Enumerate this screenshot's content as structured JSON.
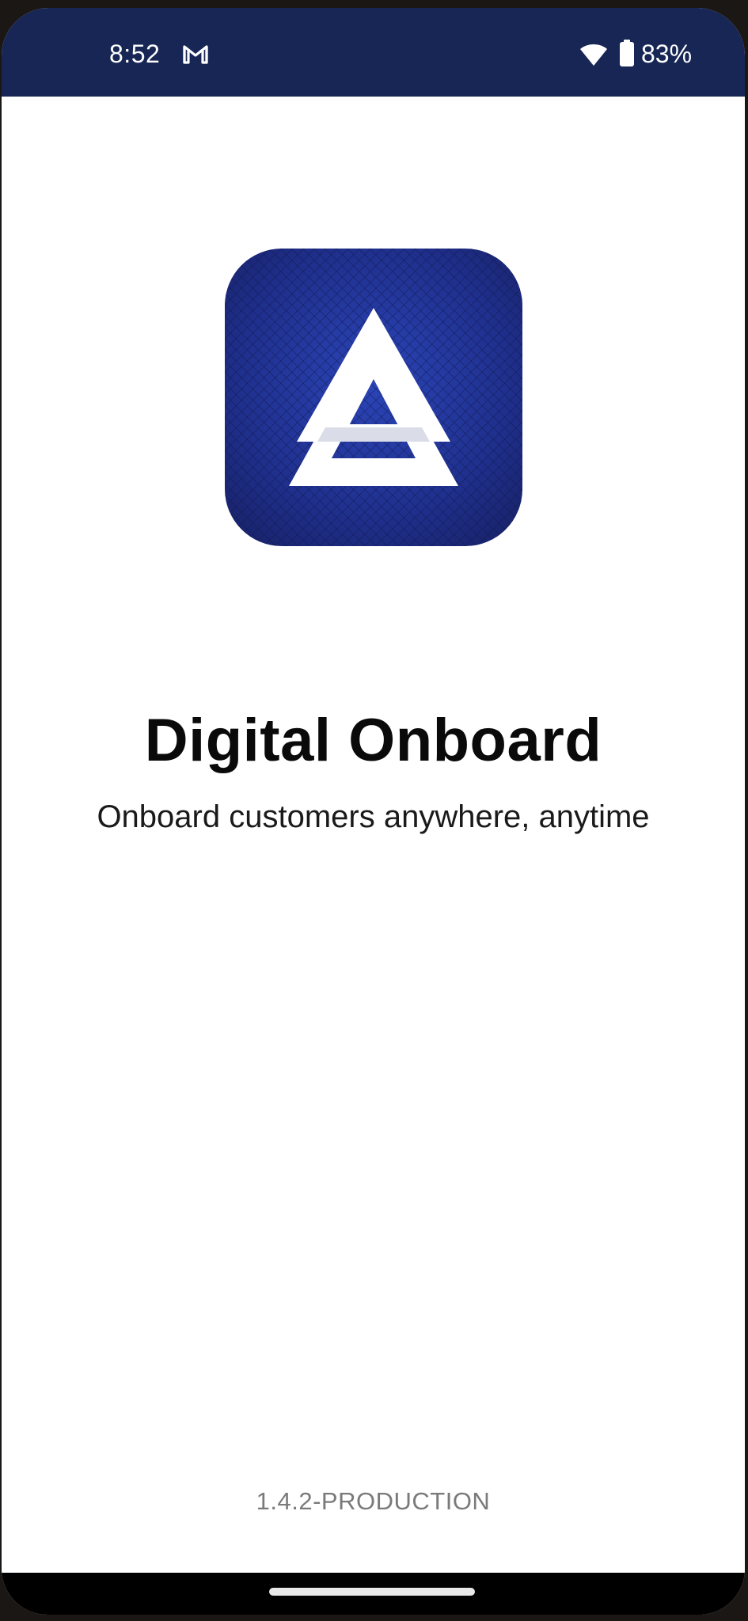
{
  "status_bar": {
    "time": "8:52",
    "notification_icon": "gmail-icon",
    "wifi_icon": "wifi-icon",
    "battery_icon": "battery-icon",
    "battery_percent": "83%",
    "battery_level": 0.83,
    "background_color": "#172654"
  },
  "splash": {
    "logo_icon": "triangle-logo-icon",
    "logo_color": "#1e2f8a",
    "title": "Digital Onboard",
    "tagline": "Onboard customers anywhere, anytime",
    "version": "1.4.2-PRODUCTION"
  },
  "navigation": {
    "home_indicator": "home-gesture-bar"
  }
}
